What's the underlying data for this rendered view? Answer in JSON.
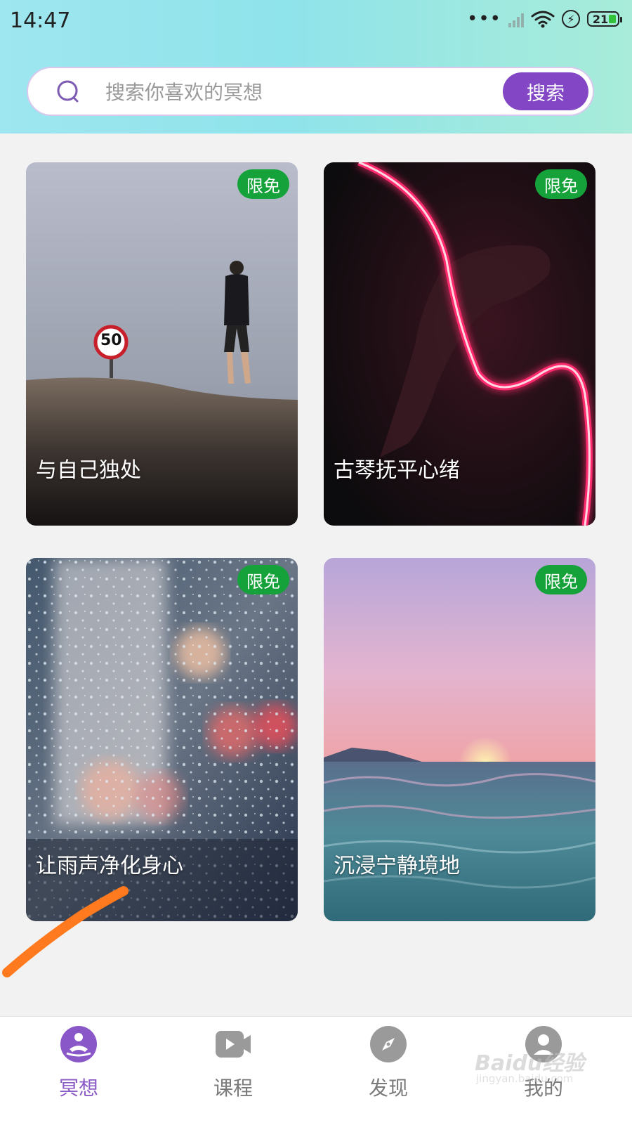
{
  "status_bar": {
    "time": "14:47",
    "battery": "21"
  },
  "search": {
    "placeholder": "搜索你喜欢的冥想",
    "button_label": "搜索"
  },
  "cards": [
    {
      "title": "与自己独处",
      "badge": "限免",
      "sign_number": "50"
    },
    {
      "title": "古琴抚平心绪",
      "badge": "限免"
    },
    {
      "title": "让雨声净化身心",
      "badge": "限免"
    },
    {
      "title": "沉浸宁静境地",
      "badge": "限免"
    }
  ],
  "tabs": [
    {
      "label": "冥想",
      "icon": "meditation-icon",
      "active": true
    },
    {
      "label": "课程",
      "icon": "video-icon"
    },
    {
      "label": "发现",
      "icon": "compass-icon"
    },
    {
      "label": "我的",
      "icon": "profile-icon"
    }
  ],
  "watermark": {
    "brand": "Baidu经验",
    "url": "jingyan.baidu.com"
  },
  "colors": {
    "accent": "#8346c4",
    "badge": "#15a23a",
    "annotation": "#ff7a1f"
  }
}
